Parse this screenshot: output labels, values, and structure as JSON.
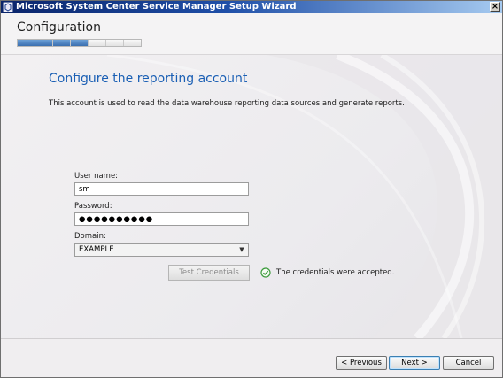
{
  "window": {
    "title": "Microsoft System Center Service Manager Setup Wizard",
    "close_glyph": "×"
  },
  "header": {
    "page_title": "Configuration",
    "progress": {
      "completed_steps": 4,
      "total_steps": 7
    }
  },
  "main": {
    "heading": "Configure the reporting account",
    "description": "This account is used to read the data warehouse reporting data sources and generate reports.",
    "username_label": "User name:",
    "username_value": "sm",
    "password_label": "Password:",
    "password_value": "●●●●●●●●●●",
    "domain_label": "Domain:",
    "domain_value": "EXAMPLE",
    "test_button": "Test Credentials",
    "status_text": "The credentials were accepted.",
    "status_icon": "check-circle-icon"
  },
  "footer": {
    "previous": "< Previous",
    "next": "Next >",
    "cancel": "Cancel"
  },
  "colors": {
    "accent_heading": "#1a5fb4",
    "progress_fill": "#3a6fb0",
    "success": "#3a9a3a"
  }
}
